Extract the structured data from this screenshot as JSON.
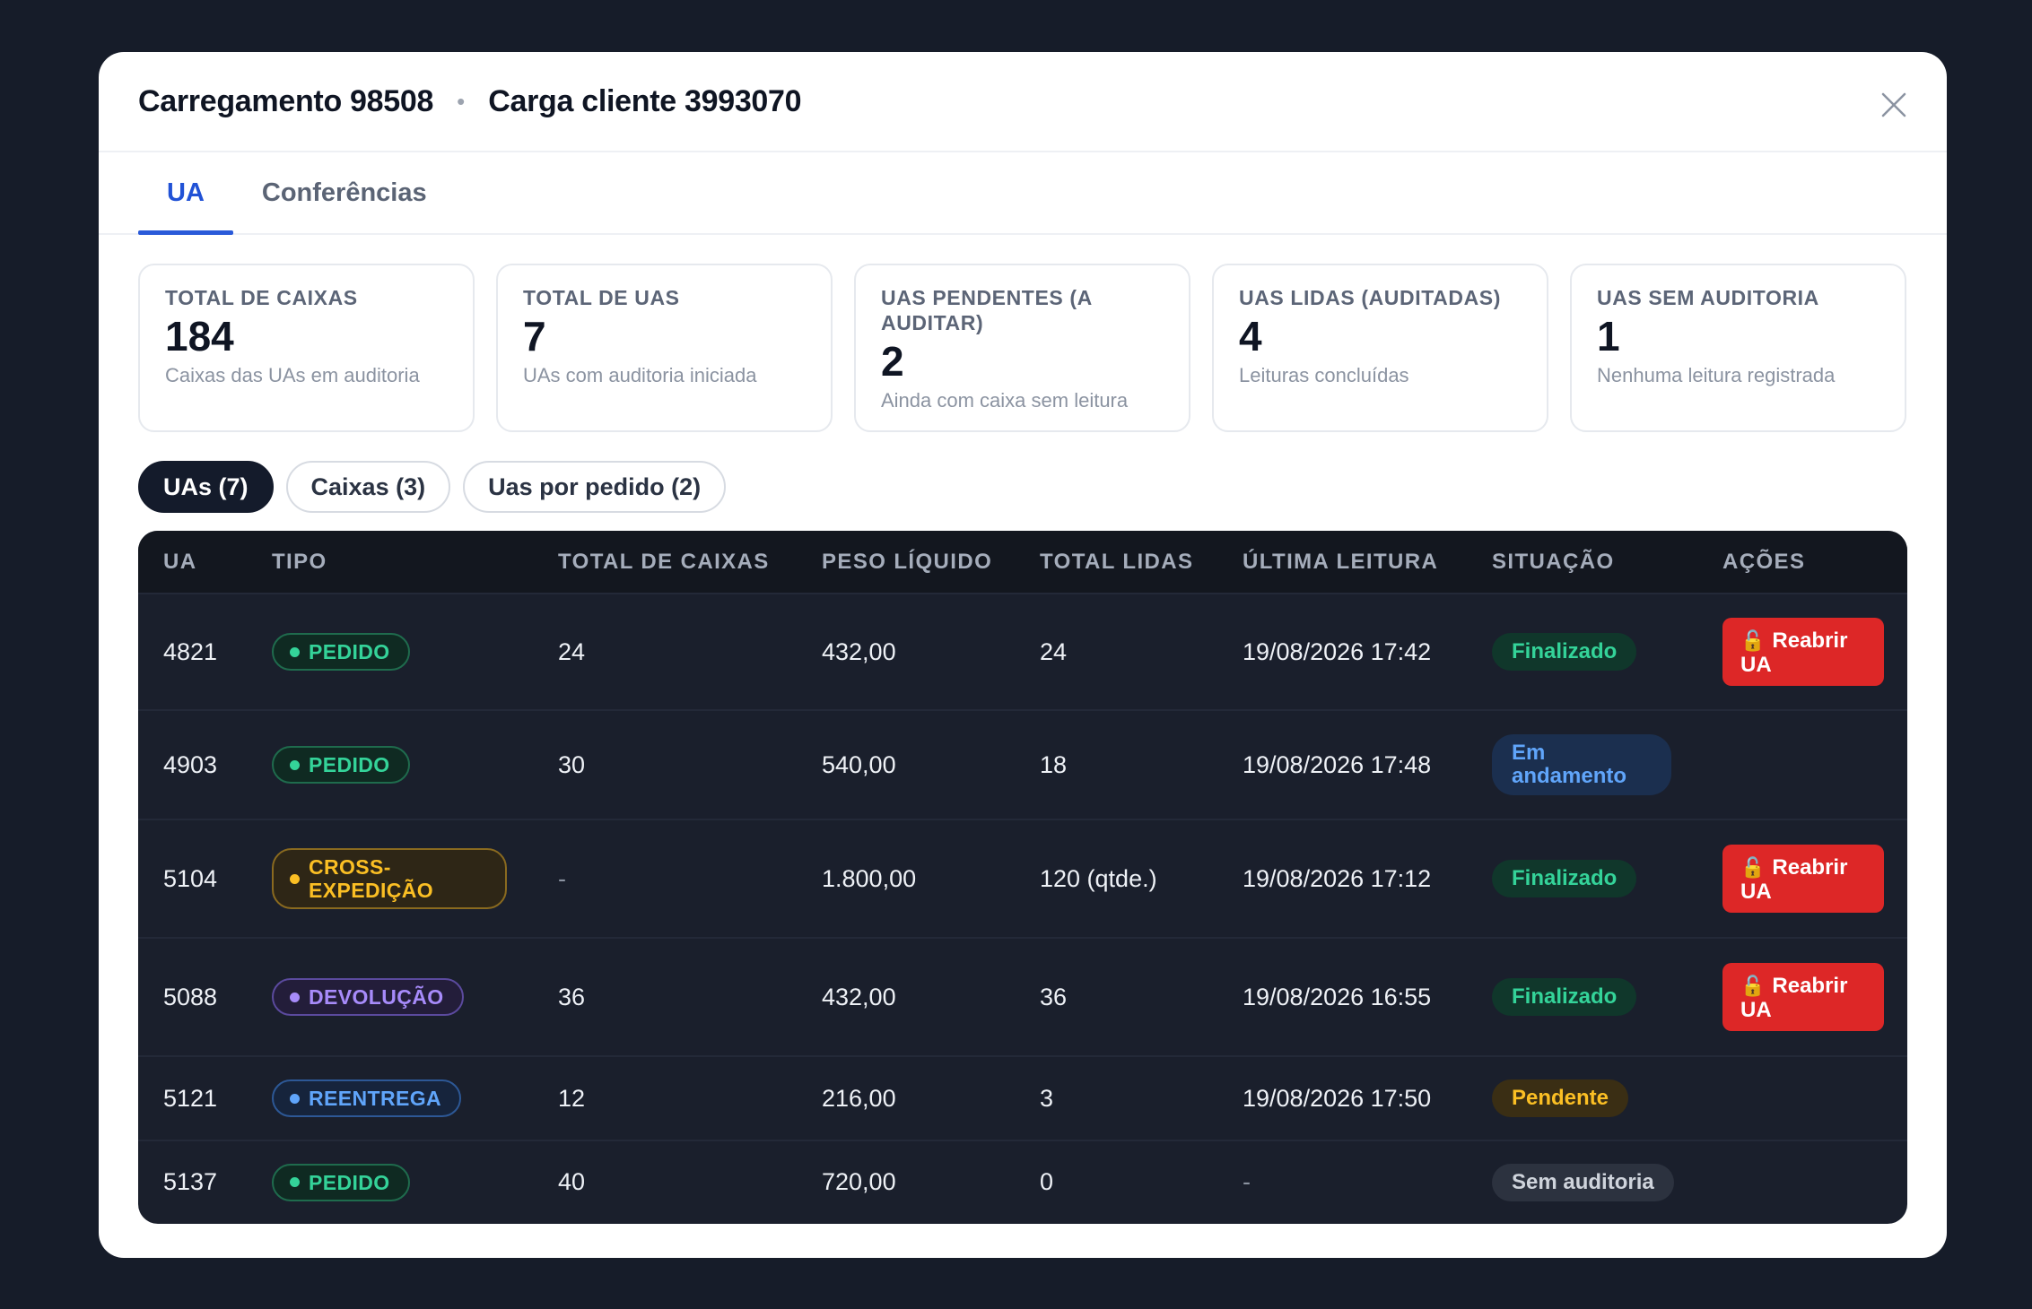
{
  "header": {
    "title_left": "Carregamento 98508",
    "separator": "•",
    "title_right": "Carga cliente 3993070",
    "close_icon": "close-icon"
  },
  "tabs": [
    {
      "label": "UA",
      "active": true
    },
    {
      "label": "Conferências",
      "active": false
    }
  ],
  "stats": [
    {
      "label": "TOTAL DE CAIXAS",
      "value": "184",
      "sub": "Caixas das UAs em auditoria"
    },
    {
      "label": "TOTAL DE UAS",
      "value": "7",
      "sub": "UAs com auditoria iniciada"
    },
    {
      "label": "UAS PENDENTES (A AUDITAR)",
      "value": "2",
      "sub": "Ainda com caixa sem leitura"
    },
    {
      "label": "UAS LIDAS (AUDITADAS)",
      "value": "4",
      "sub": "Leituras concluídas"
    },
    {
      "label": "UAS SEM AUDITORIA",
      "value": "1",
      "sub": "Nenhuma leitura registrada"
    }
  ],
  "filters": [
    {
      "label": "UAs (7)",
      "active": true
    },
    {
      "label": "Caixas (3)",
      "active": false
    },
    {
      "label": "Uas por pedido (2)",
      "active": false
    }
  ],
  "table": {
    "columns": [
      "UA",
      "TIPO",
      "TOTAL DE CAIXAS",
      "PESO LÍQUIDO",
      "TOTAL LIDAS",
      "ÚLTIMA LEITURA",
      "SITUAÇÃO",
      "AÇÕES"
    ],
    "rows": [
      {
        "ua": "4821",
        "tipo": "PEDIDO",
        "tipo_color": "green",
        "caixas": "24",
        "peso": "432,00",
        "lidas": "24",
        "leitura": "19/08/2026 17:42",
        "situacao": "Finalizado",
        "situacao_color": "green",
        "acao": "Reabrir UA"
      },
      {
        "ua": "4903",
        "tipo": "PEDIDO",
        "tipo_color": "green",
        "caixas": "30",
        "peso": "540,00",
        "lidas": "18",
        "leitura": "19/08/2026 17:48",
        "situacao": "Em andamento",
        "situacao_color": "blue",
        "acao": ""
      },
      {
        "ua": "5104",
        "tipo": "CROSS-EXPEDIÇÃO",
        "tipo_color": "amber",
        "caixas": "-",
        "peso": "1.800,00",
        "lidas": "120 (qtde.)",
        "leitura": "19/08/2026 17:12",
        "situacao": "Finalizado",
        "situacao_color": "green",
        "acao": "Reabrir UA"
      },
      {
        "ua": "5088",
        "tipo": "DEVOLUÇÃO",
        "tipo_color": "purple",
        "caixas": "36",
        "peso": "432,00",
        "lidas": "36",
        "leitura": "19/08/2026 16:55",
        "situacao": "Finalizado",
        "situacao_color": "green",
        "acao": "Reabrir UA"
      },
      {
        "ua": "5121",
        "tipo": "REENTREGA",
        "tipo_color": "blue",
        "caixas": "12",
        "peso": "216,00",
        "lidas": "3",
        "leitura": "19/08/2026 17:50",
        "situacao": "Pendente",
        "situacao_color": "amber",
        "acao": ""
      },
      {
        "ua": "5137",
        "tipo": "PEDIDO",
        "tipo_color": "green",
        "caixas": "40",
        "peso": "720,00",
        "lidas": "0",
        "leitura": "-",
        "situacao": "Sem auditoria",
        "situacao_color": "gray",
        "acao": ""
      }
    ]
  },
  "colors": {
    "accent": "#2a5ad9",
    "danger": "#dd2727",
    "green": "#34d399",
    "amber": "#fbbf24",
    "purple": "#a78bfa",
    "blue": "#60a5fa",
    "gray": "#d1d5db"
  }
}
